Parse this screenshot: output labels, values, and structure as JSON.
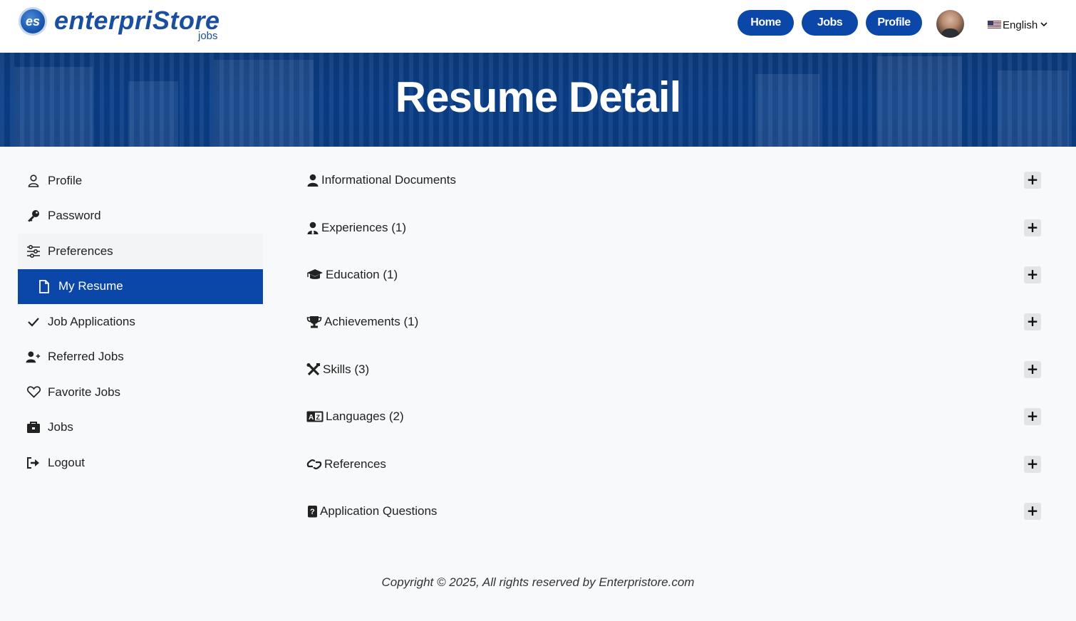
{
  "header": {
    "logo_badge": "es",
    "logo_word": "enterpriStore",
    "logo_sub": "jobs",
    "nav": {
      "home": "Home",
      "jobs": "Jobs",
      "profile": "Profile"
    },
    "language": "English"
  },
  "banner": {
    "title": "Resume Detail"
  },
  "sidebar": {
    "items": [
      {
        "label": "Profile",
        "icon": "user-icon"
      },
      {
        "label": "Password",
        "icon": "key-icon"
      },
      {
        "label": "Preferences",
        "icon": "sliders-icon"
      },
      {
        "label": "My Resume",
        "icon": "file-icon"
      },
      {
        "label": "Job Applications",
        "icon": "check-icon"
      },
      {
        "label": "Referred Jobs",
        "icon": "user-plus-icon"
      },
      {
        "label": "Favorite Jobs",
        "icon": "heart-icon"
      },
      {
        "label": "Jobs",
        "icon": "briefcase-icon"
      },
      {
        "label": "Logout",
        "icon": "logout-icon"
      }
    ]
  },
  "sections": [
    {
      "label": "Informational Documents",
      "icon": "user-icon"
    },
    {
      "label": "Experiences (1)",
      "icon": "user-tie-icon"
    },
    {
      "label": "Education (1)",
      "icon": "graduation-cap-icon"
    },
    {
      "label": "Achievements (1)",
      "icon": "trophy-icon"
    },
    {
      "label": "Skills (3)",
      "icon": "tools-icon"
    },
    {
      "label": "Languages (2)",
      "icon": "language-icon"
    },
    {
      "label": "References",
      "icon": "link-icon"
    },
    {
      "label": "Application Questions",
      "icon": "question-icon"
    }
  ],
  "expand_symbol": "+",
  "footer": {
    "copyright": "Copyright © 2025, All rights reserved by Enterpristore.com"
  },
  "colors": {
    "brand": "#0a47a8",
    "banner": "#0c3d84",
    "page_bg": "#f8f9fa"
  }
}
